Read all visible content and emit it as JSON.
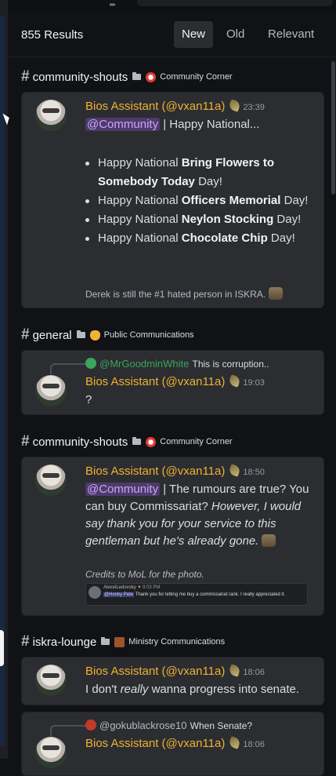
{
  "header": {
    "results": "855 Results",
    "tabs": [
      {
        "label": "New",
        "active": true
      },
      {
        "label": "Old",
        "active": false
      },
      {
        "label": "Relevant",
        "active": false
      }
    ]
  },
  "groups": [
    {
      "channel": "community-shouts",
      "category": "Community Corner",
      "category_emoji": "clown-face",
      "message": {
        "author": "Bios Assistant (@vxan11a)",
        "time": "23:39",
        "mention": "@Community",
        "text": " | Happy National...",
        "items": [
          {
            "pre": "Happy National ",
            "bold": "Bring Flowers to Somebody Today",
            "post": " Day!"
          },
          {
            "pre": "Happy National ",
            "bold": "Officers Memorial",
            "post": " Day!"
          },
          {
            "pre": "Happy National ",
            "bold": "Neylon Stocking",
            "post": " Day!"
          },
          {
            "pre": "Happy National ",
            "bold": "Chocolate Chip",
            "post": " Day!"
          }
        ],
        "footer": "Derek is still the #1 hated person in ISKRA."
      }
    },
    {
      "channel": "general",
      "category": "Public Communications",
      "category_emoji": "waving-hand",
      "message": {
        "reply_author": "@MrGoodminWhite",
        "reply_text": "This is corruption..",
        "author": "Bios Assistant (@vxan11a)",
        "time": "19:03",
        "text": "?"
      }
    },
    {
      "channel": "community-shouts",
      "category": "Community Corner",
      "category_emoji": "clown-face",
      "message": {
        "author": "Bios Assistant (@vxan11a)",
        "time": "18:50",
        "mention": "@Community",
        "text_plain": " | The rumours are true? You can buy Commissariat? ",
        "text_italic": "However, I would say thank you for your service to this gentleman but he's already gone.",
        "credits": "Credits to MoL for the photo.",
        "photo_name": "AlexeiLedovsky",
        "photo_time": "9:03 PM",
        "photo_mention": "@Honky Pete",
        "photo_text": "Thank you for letting me buy a commissariat rank. I really appreciated it."
      }
    },
    {
      "channel": "iskra-lounge",
      "category": "Ministry Communications",
      "category_emoji": "briefcase",
      "message": {
        "author": "Bios Assistant (@vxan11a)",
        "time": "18:06",
        "text_pre": "I don't ",
        "text_italic": "really",
        "text_post": " wanna progress into senate."
      }
    },
    {
      "message": {
        "reply_author": "@gokublackrose10",
        "reply_text": "When Senate?",
        "author": "Bios Assistant (@vxan11a)",
        "time": "18:06"
      }
    }
  ],
  "colors": {
    "username": "#f0b232",
    "mention_bg": "#4e3a6b",
    "card_bg": "#2b2d31",
    "reply_name": "#3ba55d"
  }
}
